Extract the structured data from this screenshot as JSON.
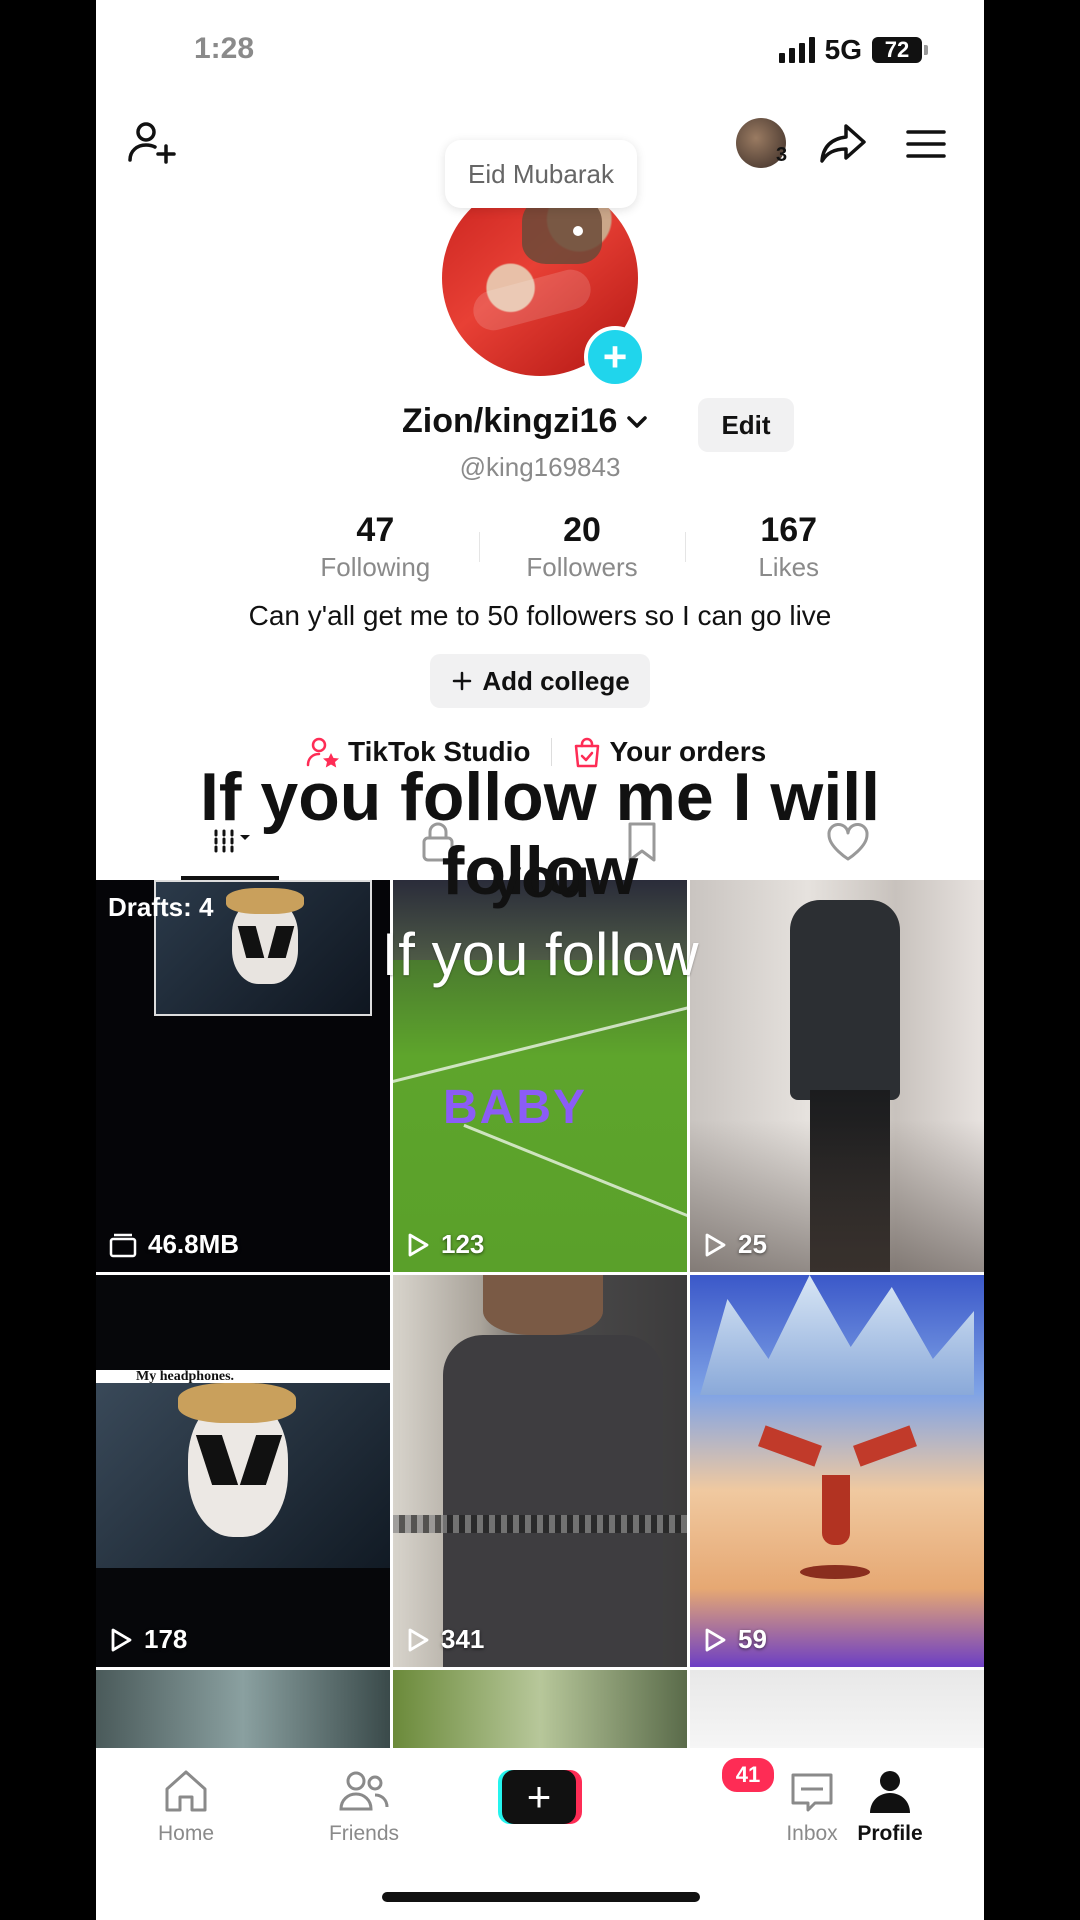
{
  "status_bar": {
    "time": "1:28",
    "network": "5G",
    "battery": "72"
  },
  "top_bar": {
    "bubble_text": "Eid Mubarak",
    "story_count": "3"
  },
  "profile": {
    "display_name": "Zion/kingzi16",
    "edit_label": "Edit",
    "username": "@king169843",
    "stats": [
      {
        "value": "47",
        "label": "Following"
      },
      {
        "value": "20",
        "label": "Followers"
      },
      {
        "value": "167",
        "label": "Likes"
      }
    ],
    "bio": "Can y'all get me to 50 followers so I can go live",
    "add_college_label": "Add college",
    "links": {
      "studio": "TikTok Studio",
      "orders": "Your orders"
    }
  },
  "overlay_text": {
    "line1": "If you  follow me I will follow",
    "line2": "you",
    "line3": "If you follow"
  },
  "grid": {
    "drafts_label": "Drafts: 4",
    "items": [
      {
        "stat": "46.8MB"
      },
      {
        "stat": "123",
        "caption": "BABY"
      },
      {
        "stat": "25"
      },
      {
        "stat": "178",
        "caption": "My headphones."
      },
      {
        "stat": "341"
      },
      {
        "stat": "59"
      }
    ]
  },
  "bottom_nav": {
    "items": [
      "Home",
      "Friends",
      "Inbox",
      "Profile"
    ],
    "inbox_badge": "41"
  },
  "colors": {
    "accent_cyan": "#25f4ee",
    "accent_red": "#fe2c55",
    "plus_blue": "#20d5ec"
  }
}
